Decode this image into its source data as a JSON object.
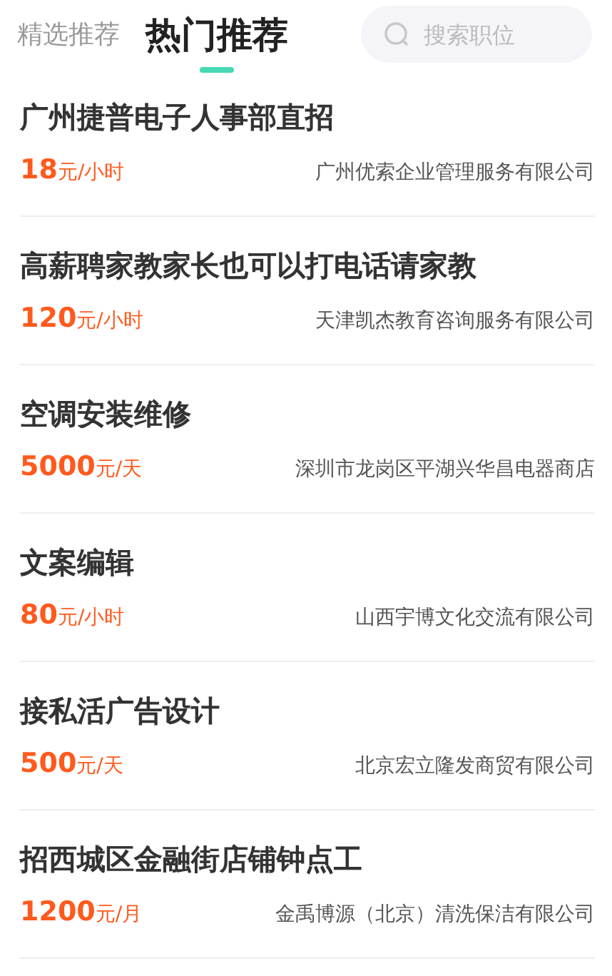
{
  "tabs": [
    {
      "label": "精选推荐",
      "selected": false
    },
    {
      "label": "热门推荐",
      "selected": true
    }
  ],
  "search": {
    "placeholder": "搜索职位"
  },
  "jobs": [
    {
      "title": "广州捷普电子人事部直招",
      "amount": "18",
      "unit": "元/小时",
      "company": "广州优索企业管理服务有限公司"
    },
    {
      "title": "高薪聘家教家长也可以打电话请家教",
      "amount": "120",
      "unit": "元/小时",
      "company": "天津凯杰教育咨询服务有限公司"
    },
    {
      "title": "空调安装维修",
      "amount": "5000",
      "unit": "元/天",
      "company": "深圳市龙岗区平湖兴华昌电器商店"
    },
    {
      "title": "文案编辑",
      "amount": "80",
      "unit": "元/小时",
      "company": "山西宇博文化交流有限公司"
    },
    {
      "title": "接私活广告设计",
      "amount": "500",
      "unit": "元/天",
      "company": "北京宏立隆发商贸有限公司"
    },
    {
      "title": "招西城区金融街店铺钟点工",
      "amount": "1200",
      "unit": "元/月",
      "company": "金禹博源（北京）清洗保洁有限公司"
    }
  ]
}
